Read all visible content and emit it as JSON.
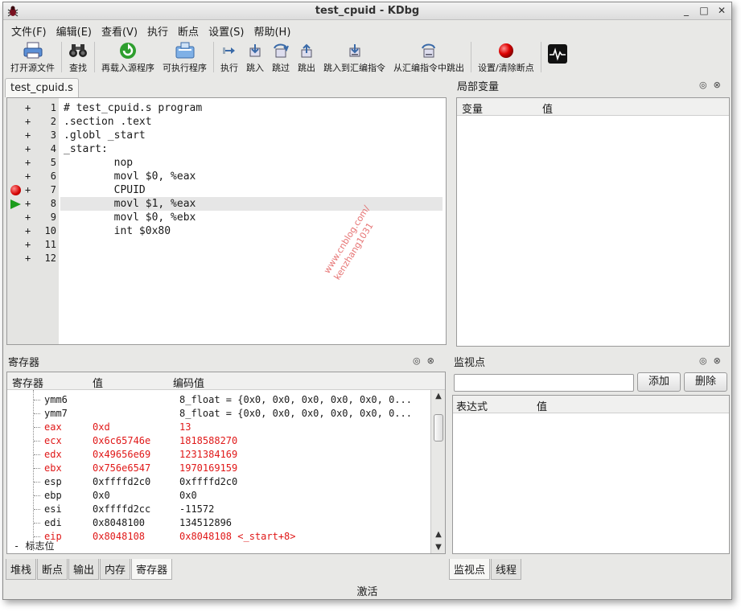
{
  "window": {
    "title": "test_cpuid - KDbg",
    "buttons": [
      "_",
      "□",
      "✕"
    ]
  },
  "menubar": [
    "文件(F)",
    "编辑(E)",
    "查看(V)",
    "执行",
    "断点",
    "设置(S)",
    "帮助(H)"
  ],
  "toolbar": {
    "open_source": "打开源文件",
    "find": "查找",
    "reload_source": "再载入源程序",
    "executable": "可执行程序",
    "run": "执行",
    "step_into": "跳入",
    "step_over": "跳过",
    "step_out": "跳出",
    "step_into_asm": "跳入到汇编指令",
    "step_out_asm": "从汇编指令中跳出",
    "toggle_breakpoint": "设置/清除断点"
  },
  "source": {
    "tab": "test_cpuid.s",
    "lines": [
      {
        "num": "1",
        "text": "# test_cpuid.s program",
        "marker": ""
      },
      {
        "num": "2",
        "text": ".section .text",
        "marker": ""
      },
      {
        "num": "3",
        "text": ".globl _start",
        "marker": ""
      },
      {
        "num": "4",
        "text": "_start:",
        "marker": ""
      },
      {
        "num": "5",
        "text": "        nop",
        "marker": ""
      },
      {
        "num": "6",
        "text": "        movl $0, %eax",
        "marker": ""
      },
      {
        "num": "7",
        "text": "        CPUID",
        "marker": "breakpoint"
      },
      {
        "num": "8",
        "text": "        movl $1, %eax",
        "marker": "current"
      },
      {
        "num": "9",
        "text": "        movl $0, %ebx",
        "marker": ""
      },
      {
        "num": "10",
        "text": "        int $0x80",
        "marker": ""
      },
      {
        "num": "11",
        "text": "",
        "marker": ""
      },
      {
        "num": "12",
        "text": "",
        "marker": ""
      }
    ],
    "expander": "+"
  },
  "locals": {
    "title": "局部变量",
    "col_var": "变量",
    "col_value": "值"
  },
  "registers": {
    "title": "寄存器",
    "col_reg": "寄存器",
    "col_value": "值",
    "col_decoded": "编码值",
    "rows": [
      {
        "name": "ymm6",
        "value": "",
        "decoded": "8_float = {0x0, 0x0, 0x0, 0x0, 0x0, 0...",
        "changed": false
      },
      {
        "name": "ymm7",
        "value": "",
        "decoded": "8_float = {0x0, 0x0, 0x0, 0x0, 0x0, 0...",
        "changed": false
      },
      {
        "name": "eax",
        "value": "0xd",
        "decoded": "13",
        "changed": true
      },
      {
        "name": "ecx",
        "value": "0x6c65746e",
        "decoded": "1818588270",
        "changed": true
      },
      {
        "name": "edx",
        "value": "0x49656e69",
        "decoded": "1231384169",
        "changed": true
      },
      {
        "name": "ebx",
        "value": "0x756e6547",
        "decoded": "1970169159",
        "changed": true
      },
      {
        "name": "esp",
        "value": "0xffffd2c0",
        "decoded": "0xffffd2c0",
        "changed": false
      },
      {
        "name": "ebp",
        "value": "0x0",
        "decoded": "0x0",
        "changed": false
      },
      {
        "name": "esi",
        "value": "0xffffd2cc",
        "decoded": "-11572",
        "changed": false
      },
      {
        "name": "edi",
        "value": "0x8048100",
        "decoded": "134512896",
        "changed": false
      },
      {
        "name": "eip",
        "value": "0x8048108",
        "decoded": "0x8048108 <_start+8>",
        "changed": true
      }
    ],
    "flags_group": "- 标志位"
  },
  "bottom_tabs_left": [
    "堆栈",
    "断点",
    "输出",
    "内存",
    "寄存器"
  ],
  "bottom_tabs_left_active": 4,
  "watch": {
    "title": "监视点",
    "add": "添加",
    "delete": "删除",
    "col_expr": "表达式",
    "col_value": "值",
    "input_value": ""
  },
  "bottom_tabs_right": [
    "监视点",
    "线程"
  ],
  "bottom_tabs_right_active": 0,
  "status": "激活",
  "watermark": [
    "www.cnblog.com/",
    "kenzhang1031"
  ],
  "colors": {
    "changed_register": "#e01818",
    "breakpoint": "#d40000",
    "current_line_arrow": "#1c9c1c"
  }
}
